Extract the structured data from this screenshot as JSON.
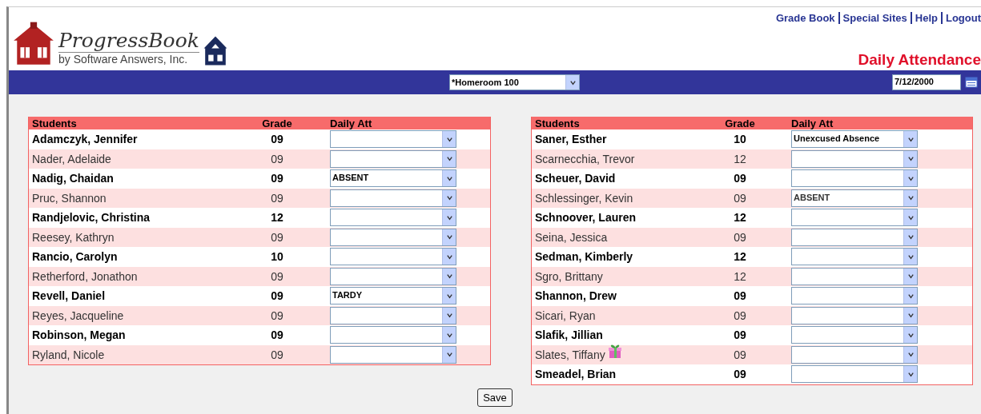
{
  "logo": {
    "name": "ProgressBook",
    "tagline": "by Software Answers, Inc."
  },
  "top_links": [
    "Grade Book",
    "Special Sites",
    "Help",
    "Logout"
  ],
  "page_title": "Daily Attendance",
  "toolbar": {
    "class_select": "*Homeroom 100",
    "date": "7/12/2000"
  },
  "tables": [
    {
      "columns": [
        "Students",
        "Grade",
        "Daily Att"
      ],
      "rows": [
        {
          "name": "Adamczyk, Jennifer",
          "grade": "09",
          "att": ""
        },
        {
          "name": "Nader, Adelaide",
          "grade": "09",
          "att": ""
        },
        {
          "name": "Nadig, Chaidan",
          "grade": "09",
          "att": "ABSENT"
        },
        {
          "name": "Pruc, Shannon",
          "grade": "09",
          "att": ""
        },
        {
          "name": "Randjelovic, Christina",
          "grade": "12",
          "att": ""
        },
        {
          "name": "Reesey, Kathryn",
          "grade": "09",
          "att": ""
        },
        {
          "name": "Rancio, Carolyn",
          "grade": "10",
          "att": ""
        },
        {
          "name": "Retherford, Jonathon",
          "grade": "09",
          "att": ""
        },
        {
          "name": "Revell, Daniel",
          "grade": "09",
          "att": "TARDY"
        },
        {
          "name": "Reyes, Jacqueline",
          "grade": "09",
          "att": ""
        },
        {
          "name": "Robinson, Megan",
          "grade": "09",
          "att": ""
        },
        {
          "name": "Ryland, Nicole",
          "grade": "09",
          "att": ""
        }
      ]
    },
    {
      "columns": [
        "Students",
        "Grade",
        "Daily Att"
      ],
      "rows": [
        {
          "name": "Saner, Esther",
          "grade": "10",
          "att": "Unexcused Absence"
        },
        {
          "name": "Scarnecchia, Trevor",
          "grade": "12",
          "att": ""
        },
        {
          "name": "Scheuer, David",
          "grade": "09",
          "att": ""
        },
        {
          "name": "Schlessinger, Kevin",
          "grade": "09",
          "att": "ABSENT"
        },
        {
          "name": "Schnoover, Lauren",
          "grade": "12",
          "att": ""
        },
        {
          "name": "Seina, Jessica",
          "grade": "09",
          "att": ""
        },
        {
          "name": "Sedman, Kimberly",
          "grade": "12",
          "att": ""
        },
        {
          "name": "Sgro, Brittany",
          "grade": "12",
          "att": ""
        },
        {
          "name": "Shannon, Drew",
          "grade": "09",
          "att": ""
        },
        {
          "name": "Sicari, Ryan",
          "grade": "09",
          "att": ""
        },
        {
          "name": "Slafik, Jillian",
          "grade": "09",
          "att": ""
        },
        {
          "name": "Slates, Tiffany",
          "grade": "09",
          "att": "",
          "birthday": true
        },
        {
          "name": "Smeadel, Brian",
          "grade": "09",
          "att": ""
        }
      ]
    }
  ],
  "save_button": "Save"
}
